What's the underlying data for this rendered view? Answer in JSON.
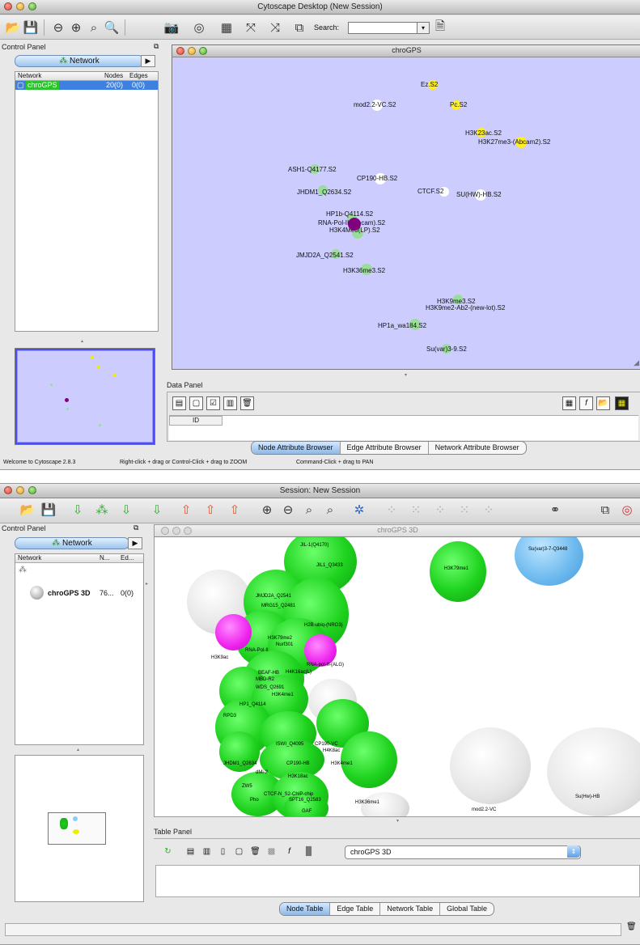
{
  "window1": {
    "title": "Cytoscape Desktop (New Session)",
    "search_label": "Search:",
    "search_value": "",
    "control_panel": {
      "title": "Control Panel",
      "tab": "Network",
      "columns": [
        "Network",
        "Nodes",
        "Edges"
      ],
      "rows": [
        {
          "name": "chroGPS",
          "nodes": "20(0)",
          "edges": "0(0)"
        }
      ]
    },
    "network_view": {
      "title": "chroGPS",
      "nodes": [
        {
          "label": "Ez.S2",
          "color": "#ffee22"
        },
        {
          "label": "mod2.2-VC.S2",
          "color": "#ffffff"
        },
        {
          "label": "Pc.S2",
          "color": "#ffee22"
        },
        {
          "label": "H3K23ac.S2",
          "color": "#ffee22"
        },
        {
          "label": "H3K27me3-(Abcam2).S2",
          "color": "#ffee22"
        },
        {
          "label": "ASH1-Q4177.S2",
          "color": "#99dd99"
        },
        {
          "label": "CP190-HB.S2",
          "color": "#ffffff"
        },
        {
          "label": "JHDM1_Q2634.S2",
          "color": "#99dd99"
        },
        {
          "label": "CTCF.S2",
          "color": "#ffffff"
        },
        {
          "label": "SU(HW)-HB.S2",
          "color": "#ffffff"
        },
        {
          "label": "HP1b-Q4114.S2",
          "color": "#99dd99"
        },
        {
          "label": "RNA-Pol-II-(Abcam).S2",
          "color": "#99dd99"
        },
        {
          "label": "H3K4Me3(LP).S2",
          "color": "#99dd99"
        },
        {
          "label": "JMJD2A_Q2541.S2",
          "color": "#99dd99"
        },
        {
          "label": "H3K36me3.S2",
          "color": "#99dd99"
        },
        {
          "label": "H3K9me3.S2",
          "color": "#99dd99"
        },
        {
          "label": "H3K9me2-Ab2-(new-lot).S2",
          "color": "#99dd99"
        },
        {
          "label": "HP1a_wa184.S2",
          "color": "#99dd99"
        },
        {
          "label": "Su(var)3-9.S2",
          "color": "#99dd99"
        },
        {
          "label": "",
          "color": "#800080"
        }
      ]
    },
    "data_panel": {
      "title": "Data Panel",
      "column": "ID",
      "tabs": [
        "Node Attribute Browser",
        "Edge Attribute Browser",
        "Network Attribute Browser"
      ]
    },
    "status": {
      "welcome": "Welcome to Cytoscape 2.8.3",
      "zoom_hint": "Right-click + drag or Control-Click + drag to ZOOM",
      "pan_hint": "Command-Click + drag to PAN"
    }
  },
  "window2": {
    "title": "Session: New Session",
    "control_panel": {
      "title": "Control Panel",
      "tab": "Network",
      "columns": [
        "Network",
        "N...",
        "Ed..."
      ],
      "rows": [
        {
          "name": "chroGPS 3D",
          "nodes": "76...",
          "edges": "0(0)"
        }
      ]
    },
    "view_title": "chroGPS 3D",
    "labels_3d": [
      "JIL-1(Q4170)",
      "JIL1_Q3433",
      "H3K79me1",
      "Su(var)3-7-Q3448",
      "JMJD2A_Q2541",
      "MRG15_Q2481",
      "H2B-ubiq-(NRO3)",
      "H3K79me2",
      "Nurf301",
      "RNA-Pol-II",
      "H3K9ac",
      "RNA-pol-II-(ALG)",
      "H4K16ac(L)",
      "BEAF-HB",
      "MBD-R2",
      "WDS_Q2691",
      "H3K4me1",
      "ISWI_Q4095",
      "CP190-VC",
      "H4K8ac",
      "JHDM1_Q2634",
      "CP190-HB",
      "dMi-2",
      "H3K18ac",
      "ZW5",
      "H3K4me1",
      "CTCF-N_S2-ChIP-chip",
      "H3K36me1",
      "mod2.2-VC",
      "Su(Hw)-HB",
      "Pho",
      "SPT16_Q2583",
      "GAF",
      "HP1_Q4114",
      "RPD3"
    ],
    "table_panel": {
      "title": "Table Panel",
      "selected_network": "chroGPS 3D",
      "tabs": [
        "Node Table",
        "Edge Table",
        "Network Table",
        "Global Table"
      ]
    }
  }
}
